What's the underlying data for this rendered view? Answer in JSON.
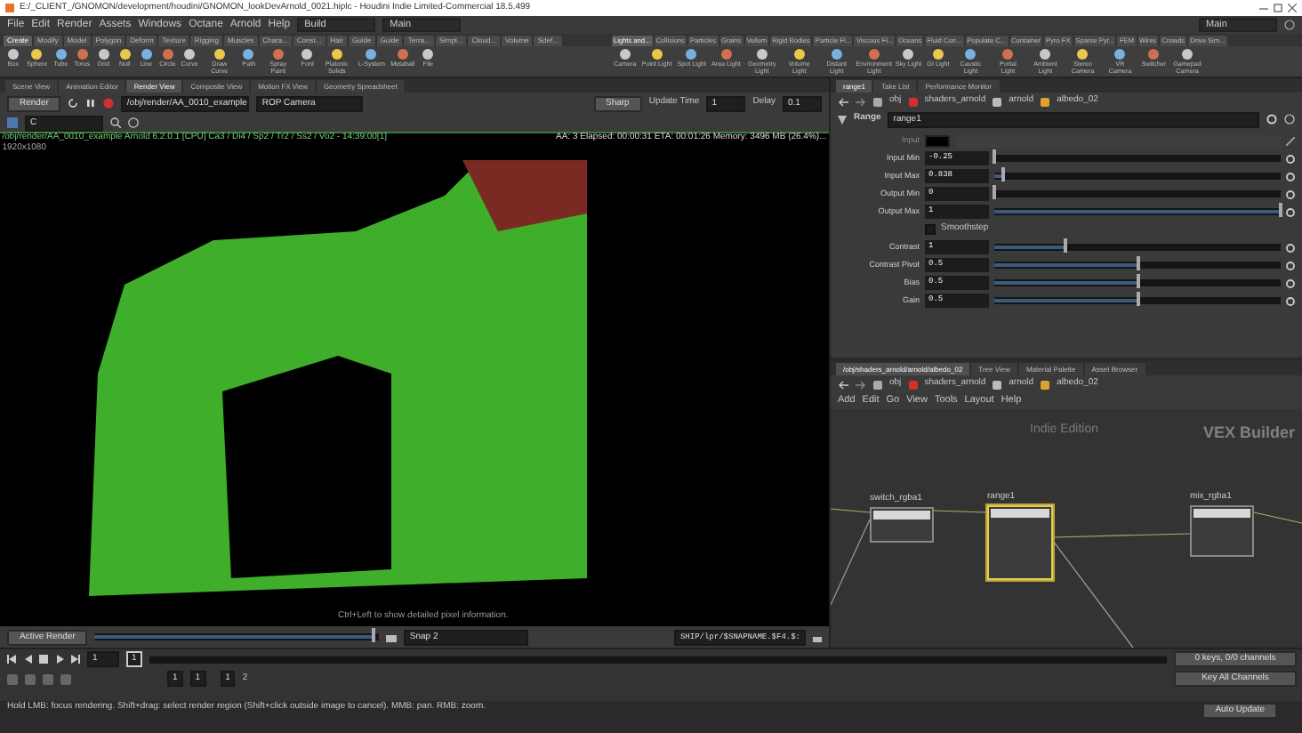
{
  "window": {
    "title": "E:/_CLIENT_/GNOMON/development/houdini/GNOMON_lookDevArnold_0021.hiplc - Houdini Indie Limited-Commercial 18.5.499"
  },
  "menu": [
    "File",
    "Edit",
    "Render",
    "Assets",
    "Windows",
    "Octane",
    "Arnold",
    "Help"
  ],
  "desktops": [
    "Build",
    "Main"
  ],
  "right_desktop": "Main",
  "shelf_left": {
    "tabs": [
      {
        "label": "Create",
        "selected": true
      },
      {
        "label": "Modify",
        "selected": false
      },
      {
        "label": "Model",
        "selected": false
      },
      {
        "label": "Polygon",
        "selected": false
      },
      {
        "label": "Deform",
        "selected": false
      },
      {
        "label": "Texture",
        "selected": false
      },
      {
        "label": "Rigging",
        "selected": false
      },
      {
        "label": "Muscles",
        "selected": false
      },
      {
        "label": "Chara...",
        "selected": false
      },
      {
        "label": "Const...",
        "selected": false
      },
      {
        "label": "Hair",
        "selected": false
      },
      {
        "label": "Guide",
        "selected": false
      },
      {
        "label": "Guide",
        "selected": false
      },
      {
        "label": "Terra...",
        "selected": false
      },
      {
        "label": "Simpl...",
        "selected": false
      },
      {
        "label": "Cloud...",
        "selected": false
      },
      {
        "label": "Volume",
        "selected": false
      },
      {
        "label": "Sdef...",
        "selected": false
      }
    ],
    "tools": [
      "Box",
      "Sphere",
      "Tube",
      "Torus",
      "Grid",
      "Null",
      "Line",
      "Circle",
      "Curve",
      "Draw Curve",
      "Path",
      "Spray Paint",
      "Font",
      "Platonic Solids",
      "L-System",
      "Metaball",
      "File"
    ]
  },
  "shelf_right": {
    "tabs": [
      {
        "label": "Lights and...",
        "selected": true
      },
      {
        "label": "Collisions",
        "selected": false
      },
      {
        "label": "Particles",
        "selected": false
      },
      {
        "label": "Grains",
        "selected": false
      },
      {
        "label": "Vellum",
        "selected": false
      },
      {
        "label": "Rigid Bodies",
        "selected": false
      },
      {
        "label": "Particle Fl...",
        "selected": false
      },
      {
        "label": "Viscous Fl...",
        "selected": false
      },
      {
        "label": "Oceans",
        "selected": false
      },
      {
        "label": "Fluid Con...",
        "selected": false
      },
      {
        "label": "Populate C...",
        "selected": false
      },
      {
        "label": "Container",
        "selected": false
      },
      {
        "label": "Pyro FX",
        "selected": false
      },
      {
        "label": "Sparse Pyr...",
        "selected": false
      },
      {
        "label": "FEM",
        "selected": false
      },
      {
        "label": "Wires",
        "selected": false
      },
      {
        "label": "Crowds",
        "selected": false
      },
      {
        "label": "Drive Sim...",
        "selected": false
      }
    ],
    "tools": [
      "Camera",
      "Point Light",
      "Spot Light",
      "Area Light",
      "Geometry Light",
      "Volume Light",
      "Distant Light",
      "Environment Light",
      "Sky Light",
      "GI Light",
      "Caustic Light",
      "Portal Light",
      "Ambient Light",
      "Stereo Camera",
      "VR Camera",
      "Switcher",
      "Gamepad Camera"
    ]
  },
  "render_pane": {
    "tabs": [
      {
        "label": "Scene View",
        "selected": false
      },
      {
        "label": "Animation Editor",
        "selected": false
      },
      {
        "label": "Render View",
        "selected": true
      },
      {
        "label": "Composite View",
        "selected": false
      },
      {
        "label": "Motion FX View",
        "selected": false
      },
      {
        "label": "Geometry Spreadsheet",
        "selected": false
      }
    ],
    "render_button": "Render",
    "rop": "/obj/render/AA_0010_example",
    "camera": "ROP Camera",
    "sharp": "Sharp",
    "update_time_label": "Update Time",
    "update_time": "1",
    "delay_label": "Delay",
    "delay": "0.1",
    "aov": "C",
    "info_left": "/obj/render/AA_0010_example  Arnold 6.2.0.1 [CPU]  Ca3 / Di4 / Sp2 / Tr2 / Ss2 / Vo2 - 14:39:00[1]",
    "resolution": "1920x1080",
    "info_right": "AA: 3  Elapsed: 00:00:31  ETA: 00:01:26  Memory: 3496 MB  (26.4%)...",
    "hint": "Ctrl+Left to show detailed pixel information.",
    "active_render": "Active Render",
    "snapshot_slider": {
      "level": 0.98
    },
    "snap": "Snap  2",
    "snap_path": "SHIP/lpr/$SNAPNAME.$F4.$:"
  },
  "parm_pane": {
    "tabs": [
      {
        "label": "range1",
        "selected": true
      },
      {
        "label": "Take List",
        "selected": false
      },
      {
        "label": "Performance Monitor",
        "selected": false
      }
    ],
    "path": [
      "obj",
      "shaders_arnold",
      "arnold",
      "albedo_02"
    ],
    "node_type": "Range",
    "node_name": "range1",
    "params": [
      {
        "kind": "color",
        "label": "Input",
        "disabled": true
      },
      {
        "kind": "slider",
        "label": "Input Min",
        "value": "-0.25",
        "level": 0.0,
        "disabled": false
      },
      {
        "kind": "slider",
        "label": "Input Max",
        "value": "0.838",
        "level": 0.03,
        "disabled": false
      },
      {
        "kind": "slider",
        "label": "Output Min",
        "value": "0",
        "level": 0.0,
        "disabled": false
      },
      {
        "kind": "slider",
        "label": "Output Max",
        "value": "1",
        "level": 1.0,
        "disabled": false
      },
      {
        "kind": "checkbox",
        "label": "Smoothstep",
        "checked": false,
        "disabled": false
      },
      {
        "kind": "slider",
        "label": "Contrast",
        "value": "1",
        "level": 0.25,
        "disabled": false
      },
      {
        "kind": "slider",
        "label": "Contrast Pivot",
        "value": "0.5",
        "level": 0.5,
        "disabled": false
      },
      {
        "kind": "slider",
        "label": "Bias",
        "value": "0.5",
        "level": 0.5,
        "disabled": false
      },
      {
        "kind": "slider",
        "label": "Gain",
        "value": "0.5",
        "level": 0.5,
        "disabled": false
      }
    ]
  },
  "network": {
    "tabs": [
      {
        "label": "/obj/shaders_arnold/arnold/albedo_02",
        "selected": true
      },
      {
        "label": "Tree View",
        "selected": false
      },
      {
        "label": "Material Palette",
        "selected": false
      },
      {
        "label": "Asset Browser",
        "selected": false
      }
    ],
    "path": [
      "obj",
      "shaders_arnold",
      "arnold",
      "albedo_02"
    ],
    "menu": [
      "Add",
      "Edit",
      "Go",
      "View",
      "Tools",
      "Layout",
      "Help"
    ],
    "edition": "Indie Edition",
    "context": "VEX Builder",
    "nodes": [
      {
        "name": "switch_rgba1",
        "selected": false
      },
      {
        "name": "range1",
        "selected": true
      },
      {
        "name": "mix_rgba1",
        "selected": false
      }
    ]
  },
  "timeline": {
    "frame": "1",
    "marker": "1",
    "range_start": "1",
    "range_end": "1",
    "end_start": "1",
    "end_end": "2",
    "keys": "0 keys, 0/0 channels",
    "key_all": "Key All Channels",
    "auto_update": "Auto Update"
  },
  "status": "Hold LMB: focus rendering. Shift+drag: select render region (Shift+click outside image to cancel). MMB: pan. RMB: zoom."
}
